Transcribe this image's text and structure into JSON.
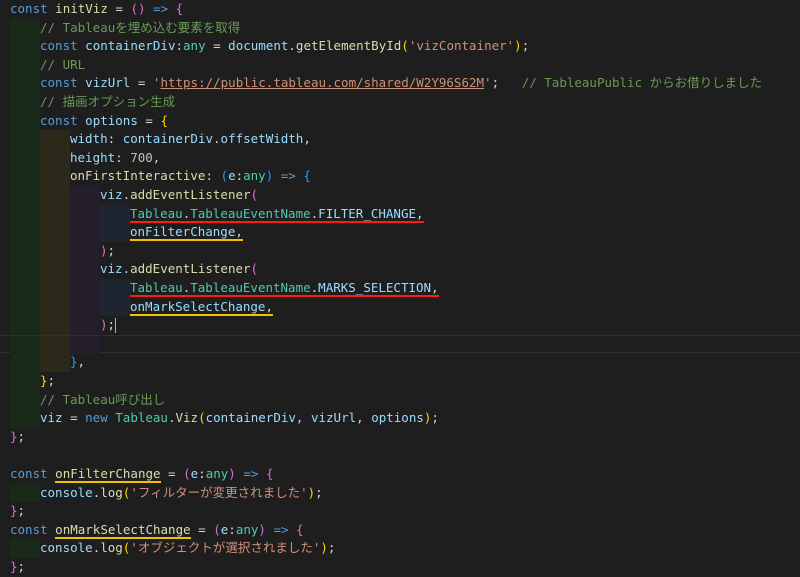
{
  "editor": {
    "lines": [
      {
        "indent": [],
        "tokens": [
          [
            "kw",
            "const"
          ],
          [
            "pl",
            " "
          ],
          [
            "fn",
            "initViz"
          ],
          [
            "pl",
            " = "
          ],
          [
            "br1",
            "()"
          ],
          [
            "pl",
            " "
          ],
          [
            "kw",
            "=>"
          ],
          [
            "pl",
            " "
          ],
          [
            "br1",
            "{"
          ]
        ]
      },
      {
        "indent": [
          "i1"
        ],
        "tokens": [
          [
            "cm",
            "// Tableauを埋め込む要素を取得"
          ]
        ]
      },
      {
        "indent": [
          "i1"
        ],
        "tokens": [
          [
            "kw",
            "const"
          ],
          [
            "pl",
            " "
          ],
          [
            "id",
            "containerDiv"
          ],
          [
            "pl",
            ":"
          ],
          [
            "cls",
            "any"
          ],
          [
            "pl",
            " = "
          ],
          [
            "id",
            "document"
          ],
          [
            "pl",
            "."
          ],
          [
            "fn",
            "getElementById"
          ],
          [
            "br2",
            "("
          ],
          [
            "str",
            "'vizContainer'"
          ],
          [
            "br2",
            ")"
          ],
          [
            "pl",
            ";"
          ]
        ]
      },
      {
        "indent": [
          "i1"
        ],
        "tokens": [
          [
            "cm",
            "// URL"
          ]
        ]
      },
      {
        "indent": [
          "i1"
        ],
        "tokens": [
          [
            "kw",
            "const"
          ],
          [
            "pl",
            " "
          ],
          [
            "id",
            "vizUrl"
          ],
          [
            "pl",
            " = "
          ],
          [
            "str",
            "'"
          ],
          [
            "str ul-str",
            "https://public.tableau.com/shared/W2Y96S62M"
          ],
          [
            "str",
            "'"
          ],
          [
            "pl",
            ";   "
          ],
          [
            "cm",
            "// TableauPublic からお借りしました"
          ]
        ]
      },
      {
        "indent": [
          "i1"
        ],
        "tokens": [
          [
            "cm",
            "// 描画オプション生成"
          ]
        ]
      },
      {
        "indent": [
          "i1"
        ],
        "tokens": [
          [
            "kw",
            "const"
          ],
          [
            "pl",
            " "
          ],
          [
            "id",
            "options"
          ],
          [
            "pl",
            " = "
          ],
          [
            "br2",
            "{"
          ]
        ]
      },
      {
        "indent": [
          "i1",
          "i2"
        ],
        "tokens": [
          [
            "id",
            "width"
          ],
          [
            "pl",
            ": "
          ],
          [
            "id",
            "containerDiv"
          ],
          [
            "pl",
            "."
          ],
          [
            "id",
            "offsetWidth"
          ],
          [
            "pl",
            ","
          ]
        ]
      },
      {
        "indent": [
          "i1",
          "i2"
        ],
        "tokens": [
          [
            "id",
            "height"
          ],
          [
            "pl",
            ": "
          ],
          [
            "num",
            "700"
          ],
          [
            "pl",
            ","
          ]
        ]
      },
      {
        "indent": [
          "i1",
          "i2"
        ],
        "tokens": [
          [
            "fn",
            "onFirstInteractive"
          ],
          [
            "pl",
            ": "
          ],
          [
            "br3",
            "("
          ],
          [
            "id",
            "e"
          ],
          [
            "pl",
            ":"
          ],
          [
            "cls",
            "any"
          ],
          [
            "br3",
            ")"
          ],
          [
            "pl",
            " "
          ],
          [
            "kw",
            "=>"
          ],
          [
            "pl",
            " "
          ],
          [
            "br3",
            "{"
          ]
        ]
      },
      {
        "indent": [
          "i1",
          "i2",
          "i3"
        ],
        "tokens": [
          [
            "id",
            "viz"
          ],
          [
            "pl",
            "."
          ],
          [
            "fn",
            "addEventListener"
          ],
          [
            "br1",
            "("
          ]
        ]
      },
      {
        "indent": [
          "i1",
          "i2",
          "i3",
          "i4"
        ],
        "tokens": [
          [
            "cls ul-red",
            "Tableau"
          ],
          [
            "pl ul-red",
            "."
          ],
          [
            "cls ul-red",
            "TableauEventName"
          ],
          [
            "pl ul-red",
            "."
          ],
          [
            "id ul-red",
            "FILTER_CHANGE"
          ],
          [
            "pl ul-red",
            ","
          ]
        ]
      },
      {
        "indent": [
          "i1",
          "i2",
          "i3",
          "i4"
        ],
        "tokens": [
          [
            "id ul-yel",
            "onFilterChange"
          ],
          [
            "pl ul-yel",
            ","
          ]
        ]
      },
      {
        "indent": [
          "i1",
          "i2",
          "i3"
        ],
        "tokens": [
          [
            "br1",
            ")"
          ],
          [
            "pl",
            ";"
          ]
        ]
      },
      {
        "indent": [
          "i1",
          "i2",
          "i3"
        ],
        "tokens": [
          [
            "id",
            "viz"
          ],
          [
            "pl",
            "."
          ],
          [
            "fn",
            "addEventListener"
          ],
          [
            "br1",
            "("
          ]
        ]
      },
      {
        "indent": [
          "i1",
          "i2",
          "i3",
          "i4"
        ],
        "tokens": [
          [
            "cls ul-red",
            "Tableau"
          ],
          [
            "pl ul-red",
            "."
          ],
          [
            "cls ul-red",
            "TableauEventName"
          ],
          [
            "pl ul-red",
            "."
          ],
          [
            "id ul-red",
            "MARKS_SELECTION"
          ],
          [
            "pl ul-red",
            ","
          ]
        ]
      },
      {
        "indent": [
          "i1",
          "i2",
          "i3",
          "i4"
        ],
        "tokens": [
          [
            "id ul-yel",
            "onMarkSelectChange"
          ],
          [
            "pl ul-yel",
            ","
          ]
        ]
      },
      {
        "indent": [
          "i1",
          "i2",
          "i3"
        ],
        "tokens": [
          [
            "br1",
            ")"
          ],
          [
            "pl",
            ";"
          ]
        ],
        "cursor": true
      },
      {
        "indent": [
          "i1",
          "i2",
          "i3"
        ],
        "tokens": [],
        "current": true
      },
      {
        "indent": [
          "i1",
          "i2"
        ],
        "tokens": [
          [
            "br3",
            "}"
          ],
          [
            "pl",
            ","
          ]
        ]
      },
      {
        "indent": [
          "i1"
        ],
        "tokens": [
          [
            "br2",
            "}"
          ],
          [
            "pl",
            ";"
          ]
        ]
      },
      {
        "indent": [
          "i1"
        ],
        "tokens": [
          [
            "cm",
            "// Tableau呼び出し"
          ]
        ]
      },
      {
        "indent": [
          "i1"
        ],
        "tokens": [
          [
            "id",
            "viz"
          ],
          [
            "pl",
            " = "
          ],
          [
            "kw",
            "new"
          ],
          [
            "pl",
            " "
          ],
          [
            "cls",
            "Tableau"
          ],
          [
            "pl",
            "."
          ],
          [
            "fn",
            "Viz"
          ],
          [
            "br2",
            "("
          ],
          [
            "id",
            "containerDiv"
          ],
          [
            "pl",
            ", "
          ],
          [
            "id",
            "vizUrl"
          ],
          [
            "pl",
            ", "
          ],
          [
            "id",
            "options"
          ],
          [
            "br2",
            ")"
          ],
          [
            "pl",
            ";"
          ]
        ]
      },
      {
        "indent": [],
        "tokens": [
          [
            "br1",
            "}"
          ],
          [
            "pl",
            ";"
          ]
        ]
      },
      {
        "indent": [],
        "tokens": []
      },
      {
        "indent": [],
        "tokens": [
          [
            "kw",
            "const"
          ],
          [
            "pl",
            " "
          ],
          [
            "fn ul-yel",
            "onFilterChange"
          ],
          [
            "pl",
            " = "
          ],
          [
            "br1",
            "("
          ],
          [
            "id",
            "e"
          ],
          [
            "pl",
            ":"
          ],
          [
            "cls",
            "any"
          ],
          [
            "br1",
            ")"
          ],
          [
            "pl",
            " "
          ],
          [
            "kw",
            "=>"
          ],
          [
            "pl",
            " "
          ],
          [
            "br1",
            "{"
          ]
        ]
      },
      {
        "indent": [
          "i1"
        ],
        "tokens": [
          [
            "id",
            "console"
          ],
          [
            "pl",
            "."
          ],
          [
            "fn",
            "log"
          ],
          [
            "br2",
            "("
          ],
          [
            "str",
            "'フィルターが変更されました'"
          ],
          [
            "br2",
            ")"
          ],
          [
            "pl",
            ";"
          ]
        ]
      },
      {
        "indent": [],
        "tokens": [
          [
            "br1",
            "}"
          ],
          [
            "pl",
            ";"
          ]
        ]
      },
      {
        "indent": [],
        "tokens": [
          [
            "kw",
            "const"
          ],
          [
            "pl",
            " "
          ],
          [
            "fn ul-yel",
            "onMarkSelectChange"
          ],
          [
            "pl",
            " = "
          ],
          [
            "br1",
            "("
          ],
          [
            "id",
            "e"
          ],
          [
            "pl",
            ":"
          ],
          [
            "cls",
            "any"
          ],
          [
            "br1",
            ")"
          ],
          [
            "pl",
            " "
          ],
          [
            "kw",
            "=>"
          ],
          [
            "pl",
            " "
          ],
          [
            "br1",
            "{"
          ]
        ]
      },
      {
        "indent": [
          "i1"
        ],
        "tokens": [
          [
            "id",
            "console"
          ],
          [
            "pl",
            "."
          ],
          [
            "fn",
            "log"
          ],
          [
            "br2",
            "("
          ],
          [
            "str",
            "'オブジェクトが選択されました'"
          ],
          [
            "br2",
            ")"
          ],
          [
            "pl",
            ";"
          ]
        ]
      },
      {
        "indent": [],
        "tokens": [
          [
            "br1",
            "}"
          ],
          [
            "pl",
            ";"
          ]
        ]
      }
    ]
  }
}
